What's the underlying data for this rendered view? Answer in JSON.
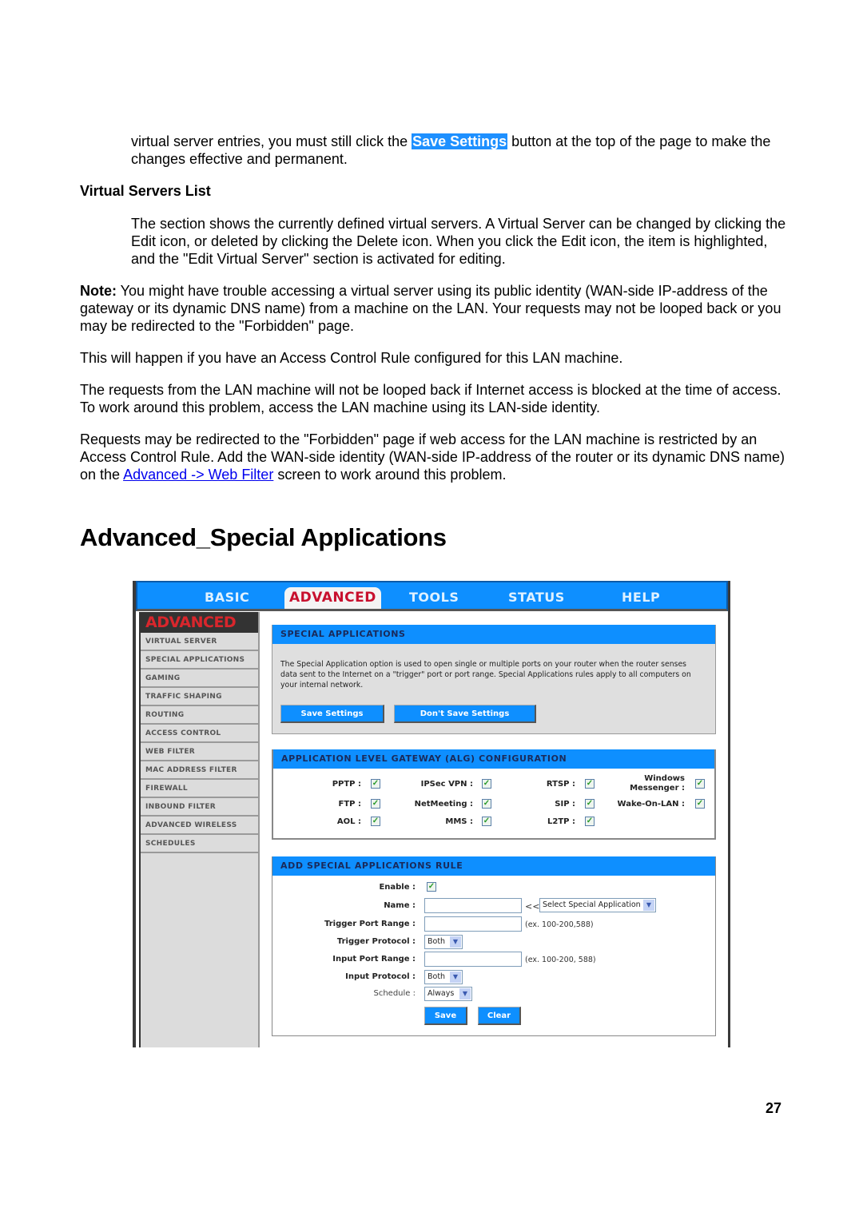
{
  "doc": {
    "para_intro": {
      "before": "virtual server entries, you must still click the ",
      "highlight": "Save Settings",
      "after": " button at the top of the page to make the changes effective and permanent."
    },
    "subheading": "Virtual Servers List",
    "para_list": "The section shows the currently defined virtual servers. A Virtual Server can be changed by clicking the Edit icon, or deleted by clicking the Delete icon. When you click the Edit icon, the item is highlighted, and the \"Edit Virtual Server\" section is activated for editing.",
    "note_label": "Note:",
    "note_text": " You might have trouble accessing a virtual server using its public identity (WAN-side IP-address of the gateway or its dynamic DNS name) from a machine on the LAN. Your requests may not be looped back or you may be redirected to the \"Forbidden\" page.",
    "para_happen": "This will happen if you have an Access Control Rule configured for this LAN machine.",
    "para_requests": "The requests from the LAN machine will not be looped back if Internet access is blocked at the time of access. To work around this problem, access the LAN machine using its LAN-side identity.",
    "para_redirect": {
      "before": "Requests may be redirected to the \"Forbidden\" page if web access for the LAN machine is restricted by an Access Control Rule. Add the WAN-side identity (WAN-side IP-address of the router or its dynamic DNS name) on the ",
      "link": "Advanced -> Web Filter",
      "after": " screen to work around this problem."
    },
    "heading": "Advanced_Special Applications",
    "page_number": "27"
  },
  "router": {
    "tabs": [
      "BASIC",
      "ADVANCED",
      "TOOLS",
      "STATUS",
      "HELP"
    ],
    "active_tab": "ADVANCED",
    "sidebar_title": "ADVANCED",
    "sidebar_items": [
      "VIRTUAL SERVER",
      "SPECIAL APPLICATIONS",
      "GAMING",
      "TRAFFIC SHAPING",
      "ROUTING",
      "ACCESS CONTROL",
      "WEB FILTER",
      "MAC ADDRESS FILTER",
      "FIREWALL",
      "INBOUND FILTER",
      "ADVANCED WIRELESS",
      "SCHEDULES"
    ],
    "special_apps": {
      "title": "SPECIAL APPLICATIONS",
      "description": "The Special Application option is used to open single or multiple ports on your router when the router senses data sent to the Internet on a \"trigger\" port or port range. Special Applications rules apply to all computers on your internal network.",
      "save_label": "Save Settings",
      "dont_save_label": "Don't Save Settings"
    },
    "alg": {
      "title": "APPLICATION LEVEL GATEWAY (ALG) CONFIGURATION",
      "items": [
        {
          "label": "PPTP :",
          "checked": true
        },
        {
          "label": "IPSec VPN :",
          "checked": true
        },
        {
          "label": "RTSP :",
          "checked": true
        },
        {
          "label": "Windows Messenger :",
          "line1": "Windows",
          "line2": "Messenger :",
          "checked": true
        },
        {
          "label": "FTP :",
          "checked": true
        },
        {
          "label": "NetMeeting :",
          "checked": true
        },
        {
          "label": "SIP :",
          "checked": true
        },
        {
          "label": "Wake-On-LAN :",
          "checked": true
        },
        {
          "label": "AOL :",
          "checked": true
        },
        {
          "label": "MMS :",
          "checked": true
        },
        {
          "label": "L2TP :",
          "checked": true
        }
      ],
      "check_glyph": "✓"
    },
    "rule": {
      "title": "ADD SPECIAL APPLICATIONS RULE",
      "enable_label": "Enable :",
      "enable_checked": true,
      "name_label": "Name :",
      "name_value": "",
      "name_arrow": "<<",
      "app_select": "Select Special Application",
      "trigger_range_label": "Trigger Port Range :",
      "trigger_range_value": "",
      "trigger_range_hint": "(ex. 100-200,588)",
      "trigger_protocol_label": "Trigger Protocol :",
      "trigger_protocol": "Both",
      "input_range_label": "Input Port Range :",
      "input_range_value": "",
      "input_range_hint": "(ex. 100-200, 588)",
      "input_protocol_label": "Input Protocol :",
      "input_protocol": "Both",
      "schedule_label": "Schedule :",
      "schedule": "Always",
      "save_label": "Save",
      "clear_label": "Clear",
      "dropdown_glyph": "▼"
    }
  }
}
